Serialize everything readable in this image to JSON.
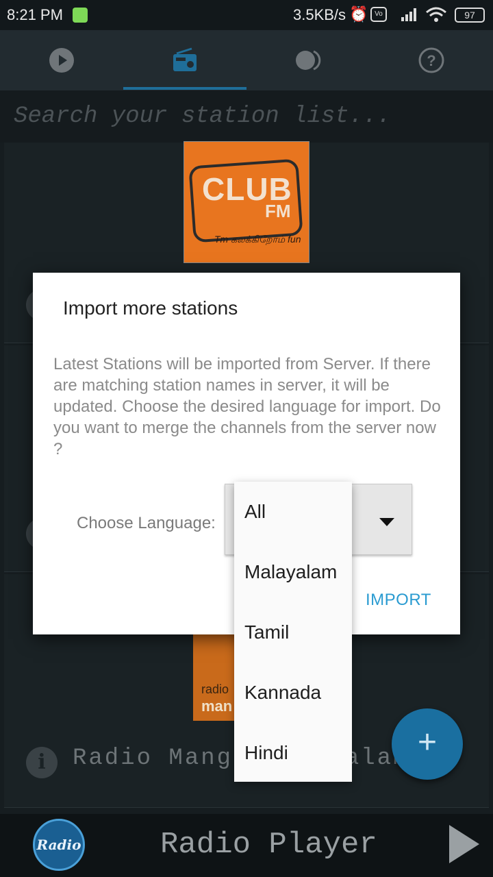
{
  "status_bar": {
    "time": "8:21 PM",
    "speed": "3.5KB/s",
    "battery": "97"
  },
  "tabs": [
    {
      "name": "tab-play",
      "icon": "play-circle-icon"
    },
    {
      "name": "tab-radio",
      "icon": "radio-icon",
      "active": true
    },
    {
      "name": "tab-theme",
      "icon": "toggle-icon"
    },
    {
      "name": "tab-help",
      "icon": "help-circle-icon"
    }
  ],
  "search": {
    "placeholder": "Search your station list..."
  },
  "station_list": {
    "club_logo": {
      "line1": "CLUB",
      "line2": "FM",
      "tagline": "Tm கலக்கிறோம் fun"
    },
    "mango_logo": {
      "line1": "radio",
      "line2": "man"
    },
    "bottom_station_name": "Radio Mango Malayalam"
  },
  "dialog": {
    "title": "Import more stations",
    "message": "Latest Stations will be imported from Server. If there are matching station names in server, it will be updated. Choose the desired language for import. Do you want to merge the channels from the server now ?",
    "language_label": "Choose Language:",
    "import_label": "IMPORT"
  },
  "language_options": [
    "All",
    "Malayalam",
    "Tamil",
    "Kannada",
    "Hindi"
  ],
  "fab": {
    "label": "+"
  },
  "player": {
    "avatar_text": "Radio",
    "title": "Radio Player"
  },
  "colors": {
    "accent": "#2a9bd1",
    "tab_active": "#1f6e99",
    "fab": "#1a6fa0"
  }
}
